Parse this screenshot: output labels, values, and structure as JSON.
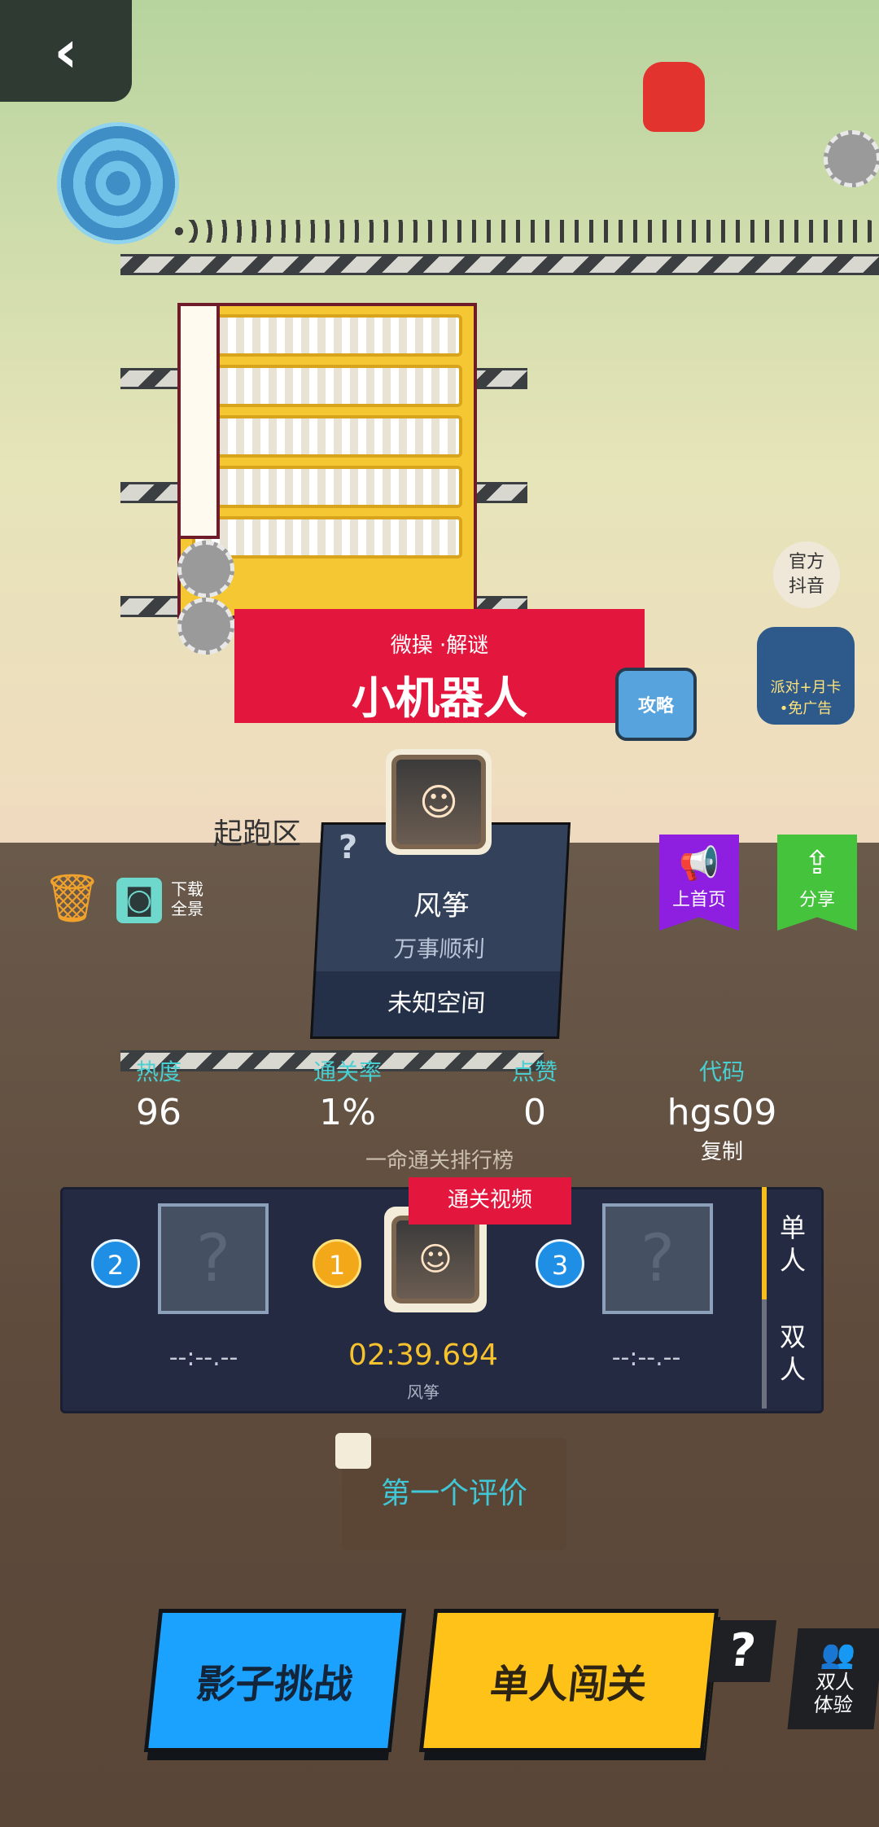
{
  "header": {
    "back_icon": "back-arrow-icon"
  },
  "level": {
    "tags": "微操 ·解谜",
    "title": "小机器人",
    "strategy_label": "攻略",
    "start_zone_label": "起跑区"
  },
  "side_buttons": {
    "official_douyin": "官方\n抖音",
    "ad_badge_line1": "派对+月卡",
    "ad_badge_line2": "•免广告"
  },
  "tools": {
    "download_label": "下载\n全景"
  },
  "creator": {
    "name": "风筝",
    "signature": "万事顺利",
    "space": "未知空间",
    "unknown_mark": "?"
  },
  "flags": {
    "home_label": "上首页",
    "share_label": "分享"
  },
  "stats": [
    {
      "label": "热度",
      "value": "96"
    },
    {
      "label": "通关率",
      "value": "1%"
    },
    {
      "label": "点赞",
      "value": "0"
    },
    {
      "label": "代码",
      "value": "hgs09",
      "extra": "复制"
    }
  ],
  "leaderboard": {
    "title": "一命通关排行榜",
    "video_tag": "通关视频",
    "tabs": [
      "单人",
      "双人"
    ],
    "ranks": [
      {
        "rank": "2",
        "time": "--:--.--"
      },
      {
        "rank": "1",
        "time": "02:39.694",
        "name": "风筝"
      },
      {
        "rank": "3",
        "time": "--:--.--"
      }
    ]
  },
  "comment": {
    "label": "第一个评价"
  },
  "actions": {
    "shadow_challenge": "影子挑战",
    "single_play": "单人闯关",
    "help": "?",
    "duo_trial": "双人\n体验"
  },
  "colors": {
    "accent_red": "#e3173d",
    "accent_blue": "#1ba2ff",
    "accent_yellow": "#ffc218",
    "teal_label": "#48cfd2",
    "purple_flag": "#8f1fe0",
    "green_flag": "#45c33d"
  }
}
